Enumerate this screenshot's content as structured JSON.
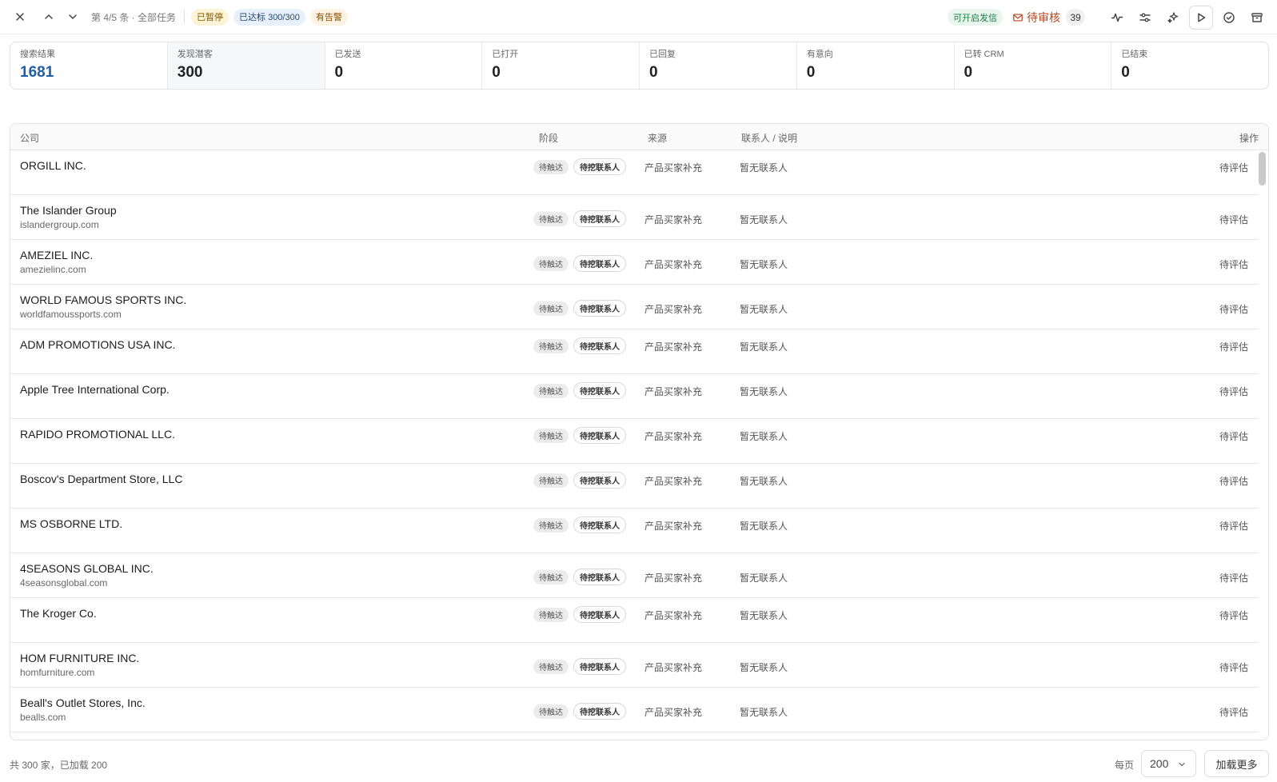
{
  "toolbar": {
    "position_text": "第 4/5 条 · 全部任务",
    "badges": {
      "paused": "已暂停",
      "target": "已达标 300/300",
      "alert": "有告警",
      "can_send": "可开启发信"
    },
    "review_label": "待审核",
    "review_count": "39"
  },
  "stats": [
    {
      "label": "搜索结果",
      "value": "1681"
    },
    {
      "label": "发现潜客",
      "value": "300"
    },
    {
      "label": "已发送",
      "value": "0"
    },
    {
      "label": "已打开",
      "value": "0"
    },
    {
      "label": "已回复",
      "value": "0"
    },
    {
      "label": "有意向",
      "value": "0"
    },
    {
      "label": "已转 CRM",
      "value": "0"
    },
    {
      "label": "已结束",
      "value": "0"
    }
  ],
  "table": {
    "headers": {
      "company": "公司",
      "stage": "阶段",
      "source": "来源",
      "contact": "联系人 / 说明",
      "action": "操作"
    },
    "rows": [
      {
        "name": "ORGILL INC.",
        "domain": "",
        "stage_primary": "待触达",
        "stage_secondary": "待挖联系人",
        "source": "产品买家补充",
        "contact": "暂无联系人",
        "action": "待评估"
      },
      {
        "name": "The Islander Group",
        "domain": "islandergroup.com",
        "stage_primary": "待触达",
        "stage_secondary": "待挖联系人",
        "source": "产品买家补充",
        "contact": "暂无联系人",
        "action": "待评估"
      },
      {
        "name": "AMEZIEL INC.",
        "domain": "amezielinc.com",
        "stage_primary": "待触达",
        "stage_secondary": "待挖联系人",
        "source": "产品买家补充",
        "contact": "暂无联系人",
        "action": "待评估"
      },
      {
        "name": "WORLD FAMOUS SPORTS INC.",
        "domain": "worldfamoussports.com",
        "stage_primary": "待触达",
        "stage_secondary": "待挖联系人",
        "source": "产品买家补充",
        "contact": "暂无联系人",
        "action": "待评估"
      },
      {
        "name": "ADM PROMOTIONS USA INC.",
        "domain": "",
        "stage_primary": "待触达",
        "stage_secondary": "待挖联系人",
        "source": "产品买家补充",
        "contact": "暂无联系人",
        "action": "待评估"
      },
      {
        "name": "Apple Tree International Corp.",
        "domain": "",
        "stage_primary": "待触达",
        "stage_secondary": "待挖联系人",
        "source": "产品买家补充",
        "contact": "暂无联系人",
        "action": "待评估"
      },
      {
        "name": "RAPIDO PROMOTIONAL LLC.",
        "domain": "",
        "stage_primary": "待触达",
        "stage_secondary": "待挖联系人",
        "source": "产品买家补充",
        "contact": "暂无联系人",
        "action": "待评估"
      },
      {
        "name": "Boscov's Department Store, LLC",
        "domain": "",
        "stage_primary": "待触达",
        "stage_secondary": "待挖联系人",
        "source": "产品买家补充",
        "contact": "暂无联系人",
        "action": "待评估"
      },
      {
        "name": "MS OSBORNE LTD.",
        "domain": "",
        "stage_primary": "待触达",
        "stage_secondary": "待挖联系人",
        "source": "产品买家补充",
        "contact": "暂无联系人",
        "action": "待评估"
      },
      {
        "name": "4SEASONS GLOBAL INC.",
        "domain": "4seasonsglobal.com",
        "stage_primary": "待触达",
        "stage_secondary": "待挖联系人",
        "source": "产品买家补充",
        "contact": "暂无联系人",
        "action": "待评估"
      },
      {
        "name": "The Kroger Co.",
        "domain": "",
        "stage_primary": "待触达",
        "stage_secondary": "待挖联系人",
        "source": "产品买家补充",
        "contact": "暂无联系人",
        "action": "待评估"
      },
      {
        "name": "HOM FURNITURE INC.",
        "domain": "homfurniture.com",
        "stage_primary": "待触达",
        "stage_secondary": "待挖联系人",
        "source": "产品买家补充",
        "contact": "暂无联系人",
        "action": "待评估"
      },
      {
        "name": "Beall's Outlet Stores, Inc.",
        "domain": "bealls.com",
        "stage_primary": "待触达",
        "stage_secondary": "待挖联系人",
        "source": "产品买家补充",
        "contact": "暂无联系人",
        "action": "待评估"
      }
    ]
  },
  "footer": {
    "summary": "共 300 家，已加载 200",
    "per_page_label": "每页",
    "per_page_value": "200",
    "load_more": "加载更多"
  },
  "icons": [
    "close-icon",
    "chevron-up-icon",
    "chevron-down-icon",
    "mail-icon",
    "activity-icon",
    "sliders-icon",
    "sparkles-icon",
    "play-icon",
    "check-circle-icon",
    "archive-icon"
  ],
  "colors": {
    "accent": "#1f5fa8",
    "review": "#b3441f",
    "paused_badge": "#fdf3d6",
    "target_badge": "#e8f0fb",
    "alert_badge": "#fdf3e3",
    "send_badge": "#e9f6ee"
  }
}
